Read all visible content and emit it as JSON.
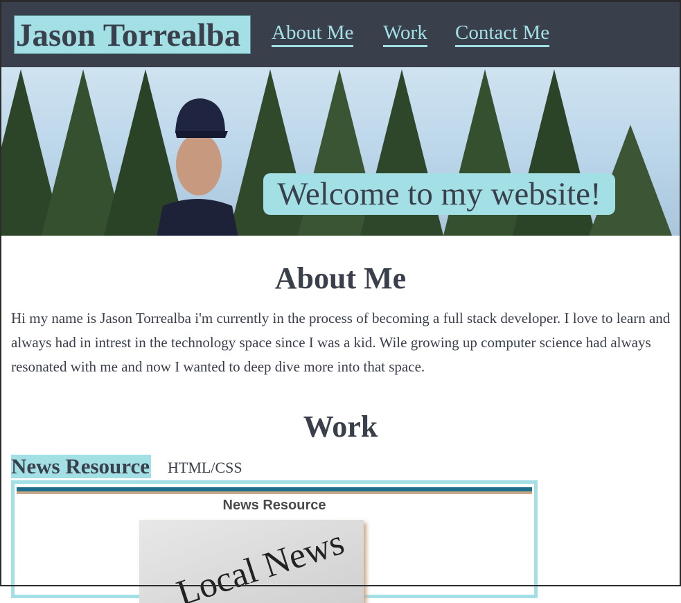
{
  "header": {
    "brand": "Jason Torrealba",
    "nav": [
      "About Me",
      "Work",
      "Contact Me"
    ]
  },
  "hero": {
    "welcome": "Welcome to my website!"
  },
  "about": {
    "heading": "About Me",
    "text": "Hi my name is Jason Torrealba i'm currently in the process of becoming a full stack developer. I love to learn and always had in intrest in the technology space since I was a kid. Wile growing up computer science had always resonated with me and now I wanted to deep dive more into that space."
  },
  "work": {
    "heading": "Work",
    "projects": [
      {
        "title": "News Resource",
        "tag": "HTML/CSS",
        "preview_title": "News Resource",
        "preview_image_text": "Local News"
      }
    ]
  }
}
